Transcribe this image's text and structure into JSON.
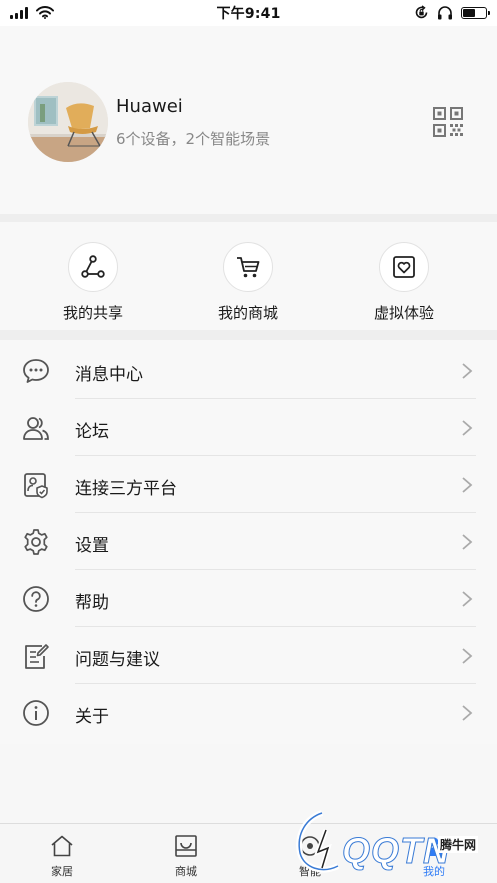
{
  "status_bar": {
    "time": "下午9:41",
    "battery_level": 0.55
  },
  "profile": {
    "name": "Huawei",
    "subtitle": "6个设备，2个智能场景",
    "avatar_icon": "chair-photo-avatar",
    "qr_icon": "qr-code-icon"
  },
  "quick_actions": [
    {
      "label": "我的共享",
      "icon": "share-icon"
    },
    {
      "label": "我的商城",
      "icon": "cart-icon"
    },
    {
      "label": "虚拟体验",
      "icon": "heart-screen-icon"
    }
  ],
  "menu": [
    {
      "label": "消息中心",
      "icon": "message-icon"
    },
    {
      "label": "论坛",
      "icon": "users-icon"
    },
    {
      "label": "连接三方平台",
      "icon": "connect-platform-icon"
    },
    {
      "label": "设置",
      "icon": "gear-icon"
    },
    {
      "label": "帮助",
      "icon": "help-icon"
    },
    {
      "label": "问题与建议",
      "icon": "feedback-icon"
    },
    {
      "label": "关于",
      "icon": "info-icon"
    }
  ],
  "tabs": [
    {
      "label": "家居",
      "icon": "home-icon"
    },
    {
      "label": "商城",
      "icon": "store-icon"
    },
    {
      "label": "智能",
      "icon": "smart-icon"
    },
    {
      "label": "我的",
      "icon": "me-icon"
    }
  ],
  "watermark": {
    "brand": "QQTN",
    "site_name": "腾牛网"
  },
  "colors": {
    "background": "#f8f8f8",
    "band": "#eeeeee",
    "text": "#1a1a1a",
    "secondary_text": "#888888",
    "icon": "#555555",
    "watermark_accent": "#3a7bd5"
  }
}
